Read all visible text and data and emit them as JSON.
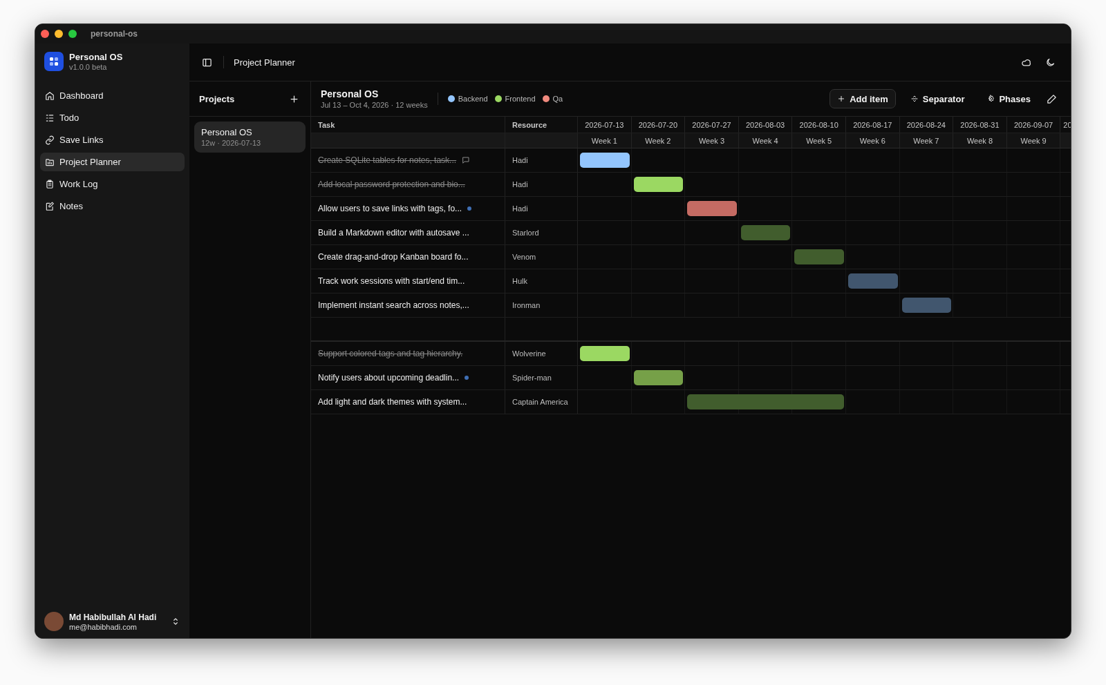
{
  "window": {
    "title": "personal-os"
  },
  "sidebar": {
    "app_name": "Personal OS",
    "version": "v1.0.0 beta",
    "items": [
      {
        "label": "Dashboard",
        "selected": false
      },
      {
        "label": "Todo",
        "selected": false
      },
      {
        "label": "Save Links",
        "selected": false
      },
      {
        "label": "Project Planner",
        "selected": true
      },
      {
        "label": "Work Log",
        "selected": false
      },
      {
        "label": "Notes",
        "selected": false
      }
    ],
    "user": {
      "name": "Md Habibullah Al Hadi",
      "email": "me@habibhadi.com"
    }
  },
  "header": {
    "title": "Project Planner"
  },
  "projects": {
    "title": "Projects",
    "items": [
      {
        "name": "Personal OS",
        "meta": "12w · 2026-07-13",
        "selected": true
      }
    ]
  },
  "planner": {
    "title": "Personal OS",
    "subtitle": "Jul 13 – Oct 4, 2026 · 12 weeks",
    "legend": [
      {
        "label": "Backend",
        "color": "#93c5fd"
      },
      {
        "label": "Frontend",
        "color": "#9bd862"
      },
      {
        "label": "Qa",
        "color": "#f08a7e"
      }
    ],
    "buttons": [
      {
        "label": "Add item",
        "kind": "add"
      },
      {
        "label": "Separator",
        "kind": "separator"
      },
      {
        "label": "Phases",
        "kind": "phases"
      }
    ],
    "columns": [
      "Task",
      "Resource"
    ],
    "weeks": [
      {
        "date": "2026-07-13",
        "label": "Week 1"
      },
      {
        "date": "2026-07-20",
        "label": "Week 2"
      },
      {
        "date": "2026-07-27",
        "label": "Week 3"
      },
      {
        "date": "2026-08-03",
        "label": "Week 4"
      },
      {
        "date": "2026-08-10",
        "label": "Week 5"
      },
      {
        "date": "2026-08-17",
        "label": "Week 6"
      },
      {
        "date": "2026-08-24",
        "label": "Week 7"
      },
      {
        "date": "2026-08-31",
        "label": "Week 8"
      },
      {
        "date": "2026-09-07",
        "label": "Week 9"
      },
      {
        "date": "20"
      }
    ],
    "rows": [
      {
        "kind": "task",
        "task": "Create SQLite tables for notes, task...",
        "resource": "Hadi",
        "done": true,
        "flagged": false,
        "has_comment": true,
        "bar": {
          "color": "#93c5fd",
          "weeks": [
            true,
            false,
            false,
            false,
            false,
            false,
            false,
            false,
            false
          ]
        }
      },
      {
        "kind": "task",
        "task": "Add local password protection and bio...",
        "resource": "Hadi",
        "done": true,
        "flagged": false,
        "has_comment": false,
        "bar": {
          "color": "#9bd862",
          "weeks": [
            false,
            true,
            false,
            false,
            false,
            false,
            false,
            false,
            false
          ]
        }
      },
      {
        "kind": "task",
        "task": "Allow users to save links with tags, fo...",
        "resource": "Hadi",
        "done": false,
        "flagged": true,
        "has_comment": false,
        "bar": {
          "color": "#c56b63",
          "weeks": [
            false,
            false,
            true,
            false,
            false,
            false,
            false,
            false,
            false
          ]
        }
      },
      {
        "kind": "task",
        "task": "Build a Markdown editor with autosave ...",
        "resource": "Starlord",
        "done": false,
        "flagged": false,
        "has_comment": false,
        "bar": {
          "color": "#415d2d",
          "weeks": [
            false,
            false,
            false,
            true,
            false,
            false,
            false,
            false,
            false
          ]
        }
      },
      {
        "kind": "task",
        "task": "Create drag-and-drop Kanban board fo...",
        "resource": "Venom",
        "done": false,
        "flagged": false,
        "has_comment": false,
        "bar": {
          "color": "#415d2d",
          "weeks": [
            false,
            false,
            false,
            false,
            true,
            false,
            false,
            false,
            false
          ]
        }
      },
      {
        "kind": "task",
        "task": "Track work sessions with start/end tim...",
        "resource": "Hulk",
        "done": false,
        "flagged": false,
        "has_comment": false,
        "bar": {
          "color": "#41566e",
          "weeks": [
            false,
            false,
            false,
            false,
            false,
            true,
            false,
            false,
            false
          ]
        }
      },
      {
        "kind": "task",
        "task": "Implement instant search across notes,...",
        "resource": "Ironman",
        "done": false,
        "flagged": false,
        "has_comment": false,
        "bar": {
          "color": "#41566e",
          "weeks": [
            false,
            false,
            false,
            false,
            false,
            false,
            true,
            false,
            false
          ]
        }
      },
      {
        "kind": "separator"
      },
      {
        "kind": "task",
        "task": "Support colored tags and tag hierarchy.",
        "resource": "Wolverine",
        "done": true,
        "flagged": false,
        "has_comment": false,
        "bar": {
          "color": "#9bd862",
          "weeks": [
            true,
            false,
            false,
            false,
            false,
            false,
            false,
            false,
            false
          ]
        }
      },
      {
        "kind": "task",
        "task": "Notify users about upcoming deadlin...",
        "resource": "Spider-man",
        "done": false,
        "flagged": true,
        "has_comment": false,
        "bar": {
          "color": "#76a048",
          "weeks": [
            false,
            true,
            false,
            false,
            false,
            false,
            false,
            false,
            false
          ]
        }
      },
      {
        "kind": "task",
        "task": "Add light and dark themes with system...",
        "resource": "Captain America",
        "done": false,
        "flagged": false,
        "has_comment": false,
        "bar": {
          "color": "#415d2d",
          "weeks": [
            false,
            false,
            true,
            true,
            true,
            false,
            false,
            false,
            false
          ]
        }
      }
    ]
  }
}
